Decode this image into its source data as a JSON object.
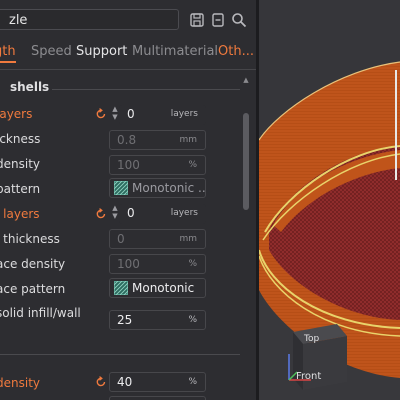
{
  "search": {
    "value": "zle"
  },
  "tabs": [
    {
      "label": "gth"
    },
    {
      "label": "Speed"
    },
    {
      "label": "Support"
    },
    {
      "label": "Multimaterial"
    },
    {
      "label": "Oth..."
    }
  ],
  "section1": {
    "title": "shells"
  },
  "rows": [
    {
      "label": "layers",
      "value": "0",
      "unit": "layers"
    },
    {
      "label": "ickness",
      "value": "0.8",
      "unit": "mm"
    },
    {
      "label": "density",
      "value": "100",
      "unit": "%"
    },
    {
      "label": "pattern",
      "value": "Monotonic ..."
    },
    {
      "label": "l layers",
      "value": "0",
      "unit": "layers"
    },
    {
      "label": "l thickness",
      "value": "0",
      "unit": "mm"
    },
    {
      "label": "ace density",
      "value": "100",
      "unit": "%"
    },
    {
      "label": "ace pattern",
      "value": "Monotonic"
    },
    {
      "label": " solid infill/wall",
      "value": "25",
      "unit": "%"
    },
    {
      "label": "density",
      "value": "40",
      "unit": "%"
    },
    {
      "label": "",
      "value": "",
      "unit": ""
    }
  ],
  "viewcube": {
    "top": "Top",
    "front": "Front"
  },
  "colors": {
    "accent": "#f07a3e",
    "filament": "#c0541a",
    "infill": "#7a2222",
    "wall_stripe": "#e9d36a"
  }
}
